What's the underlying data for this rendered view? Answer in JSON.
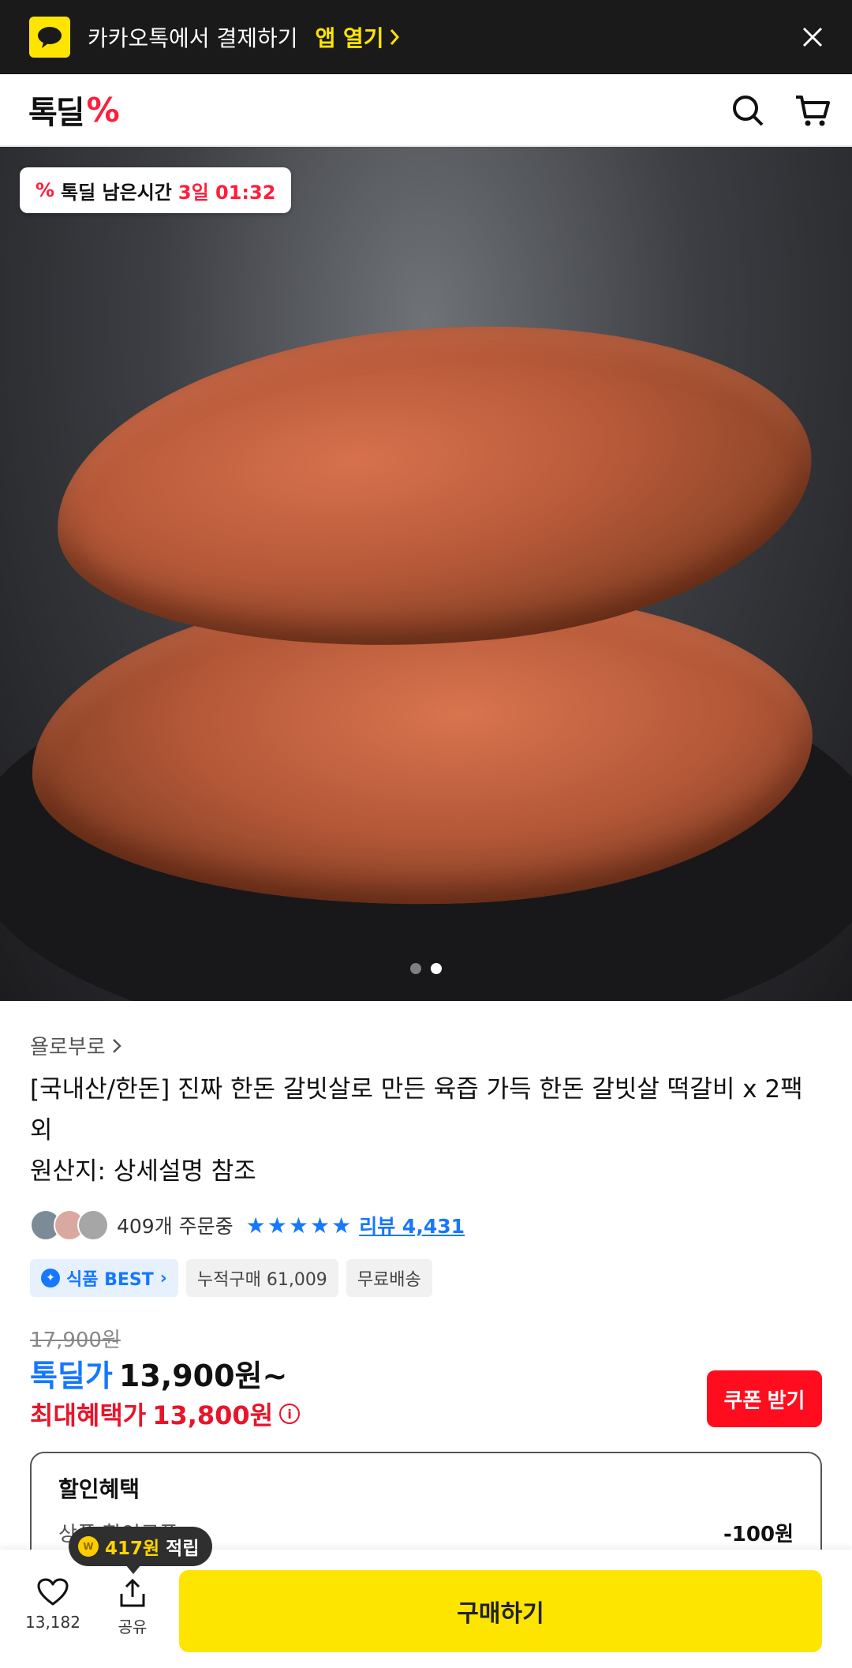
{
  "kakao_banner": {
    "text": "카카오톡에서 결제하기",
    "open_label": "앱 열기"
  },
  "header": {
    "brand": "톡딜",
    "brand_mark": "%"
  },
  "hero": {
    "timer_label": "톡딜 남은시간",
    "timer_value": "3일 01:32",
    "slide_count": 2,
    "active_slide": 2
  },
  "product": {
    "seller": "욜로부로",
    "title": "[국내산/한돈] 진짜 한돈 갈빗살로 만든 육즙 가득 한돈 갈빗살 떡갈비 x 2팩 외",
    "origin": "원산지: 상세설명 참조",
    "orders_text": "409개 주문중",
    "rating": 5,
    "review_text": "리뷰 4,431",
    "tags": {
      "best": "식품 BEST",
      "cumulative": "누적구매 61,009",
      "shipping": "무료배송"
    },
    "original_price": "17,900원",
    "deal_label": "톡딜가",
    "deal_price": "13,900원~",
    "max_benefit_label": "최대혜택가",
    "max_benefit_price": "13,800원"
  },
  "coupon_button": "쿠폰 받기",
  "discount": {
    "title": "할인혜택",
    "item_label": "상품 할인쿠폰",
    "item_value": "-100원"
  },
  "reward_tip": {
    "amount": "417원",
    "suffix": "적립"
  },
  "bottom_bar": {
    "like_count": "13,182",
    "share_label": "공유",
    "buy_label": "구매하기"
  },
  "colors": {
    "kakao_yellow": "#fee500",
    "brand_red": "#ff1d3c",
    "deal_blue": "#1677ff",
    "benefit_red": "#e8152a"
  }
}
